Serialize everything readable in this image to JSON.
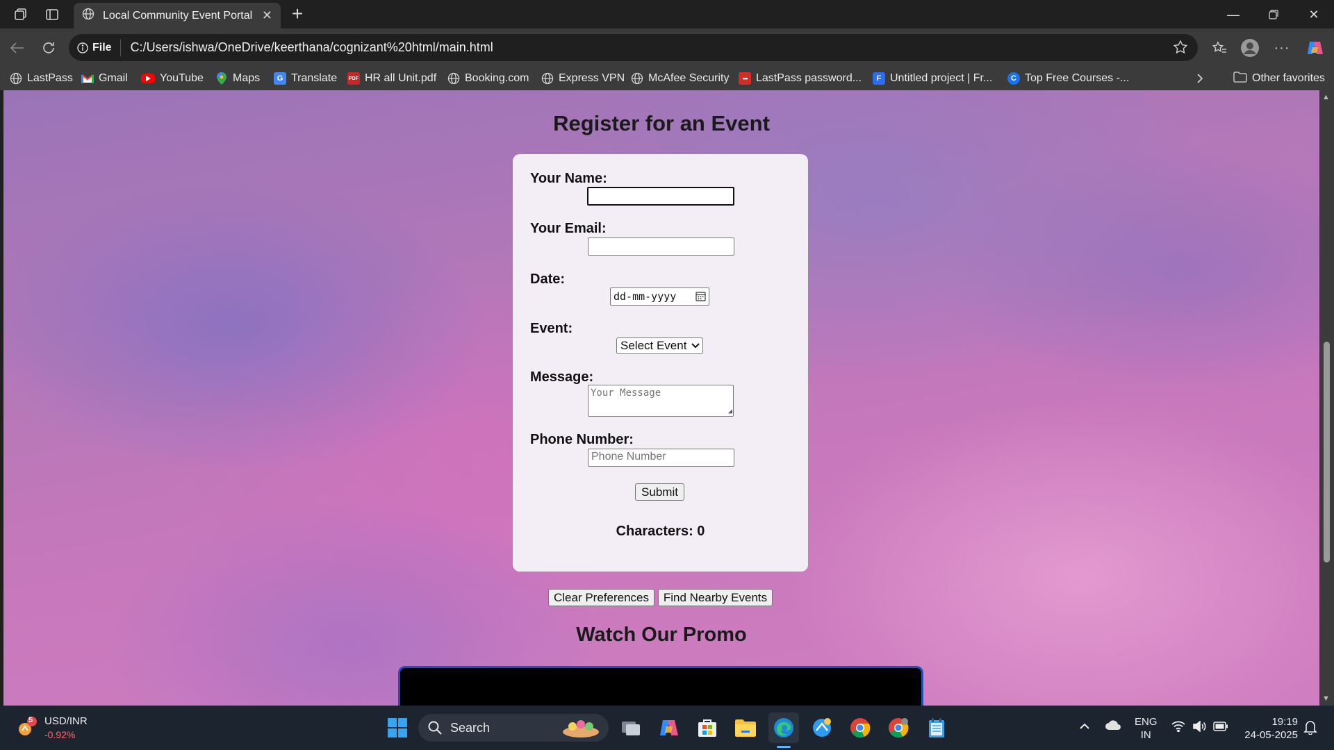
{
  "browser": {
    "tab_title": "Local Community Event Portal",
    "file_label": "File",
    "url": "C:/Users/ishwa/OneDrive/keerthana/cognizant%20html/main.html"
  },
  "bookmarks": [
    {
      "label": "LastPass",
      "icon": "globe-icon"
    },
    {
      "label": "Gmail",
      "icon": "gmail-icon"
    },
    {
      "label": "YouTube",
      "icon": "youtube-icon"
    },
    {
      "label": "Maps",
      "icon": "maps-icon"
    },
    {
      "label": "Translate",
      "icon": "translate-icon"
    },
    {
      "label": "HR all Unit.pdf",
      "icon": "pdf-icon"
    },
    {
      "label": "Booking.com",
      "icon": "globe-icon"
    },
    {
      "label": "Express VPN",
      "icon": "globe-icon"
    },
    {
      "label": "McAfee Security",
      "icon": "globe-icon"
    },
    {
      "label": "LastPass password...",
      "icon": "lastpass-icon"
    },
    {
      "label": "Untitled project | Fr...",
      "icon": "document-icon"
    },
    {
      "label": "Top Free Courses -...",
      "icon": "c-icon"
    }
  ],
  "other_favorites": "Other favorites",
  "page": {
    "heading": "Register for an Event",
    "form": {
      "name_label": "Your Name:",
      "email_label": "Your Email:",
      "date_label": "Date:",
      "date_placeholder": "dd-mm-yyyy",
      "event_label": "Event:",
      "event_selected": "Select Event",
      "message_label": "Message:",
      "message_placeholder": "Your Message",
      "phone_label": "Phone Number:",
      "phone_placeholder": "Phone Number",
      "submit_label": "Submit",
      "characters_text": "Characters: 0"
    },
    "clear_preferences_label": "Clear Preferences",
    "find_nearby_label": "Find Nearby Events",
    "promo_heading": "Watch Our Promo"
  },
  "taskbar": {
    "widget_title": "USD/INR",
    "widget_value": "-0.92%",
    "widget_badge": "5",
    "search_label": "Search",
    "lang_top": "ENG",
    "lang_bottom": "IN",
    "time": "19:19",
    "date": "24-05-2025"
  },
  "colors": {
    "card_bg": "#f3eef6",
    "video_border": "#1f4fb8",
    "taskbar_bg": "#1c2430",
    "widget_value_color": "#ff6b6b"
  }
}
